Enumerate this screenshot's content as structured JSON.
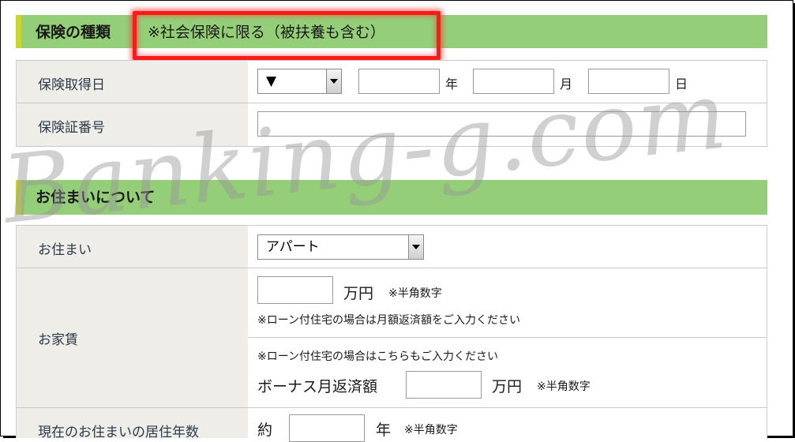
{
  "insurance_section": {
    "title": "保険の種類",
    "note": "※社会保険に限る（被扶養も含む）",
    "acquired_date": {
      "label": "保険取得日",
      "select_value": "▼",
      "year_unit": "年",
      "month_unit": "月",
      "day_unit": "日"
    },
    "card_number": {
      "label": "保険証番号"
    }
  },
  "residence_section": {
    "title": "お住まいについて",
    "residence_type": {
      "label": "お住まい",
      "select_value": "アパート"
    },
    "rent": {
      "label": "お家賃",
      "unit": "万円",
      "hint": "※半角数字",
      "loan_note": "※ローン付住宅の場合は月額返済額をご入力ください",
      "bonus_note": "※ローン付住宅の場合はこちらもご入力ください",
      "bonus_label": "ボーナス月返済額",
      "bonus_unit": "万円",
      "bonus_hint": "※半角数字"
    },
    "years_lived": {
      "label": "現在のお住まいの居住年数",
      "prefix": "約",
      "unit": "年",
      "hint": "※半角数字"
    }
  },
  "watermark": "Banking-g.com",
  "colors": {
    "section_bg": "#94ce78",
    "section_accent": "#c9d532",
    "label_bg": "#eeede8",
    "highlight": "#ff1a1a"
  }
}
